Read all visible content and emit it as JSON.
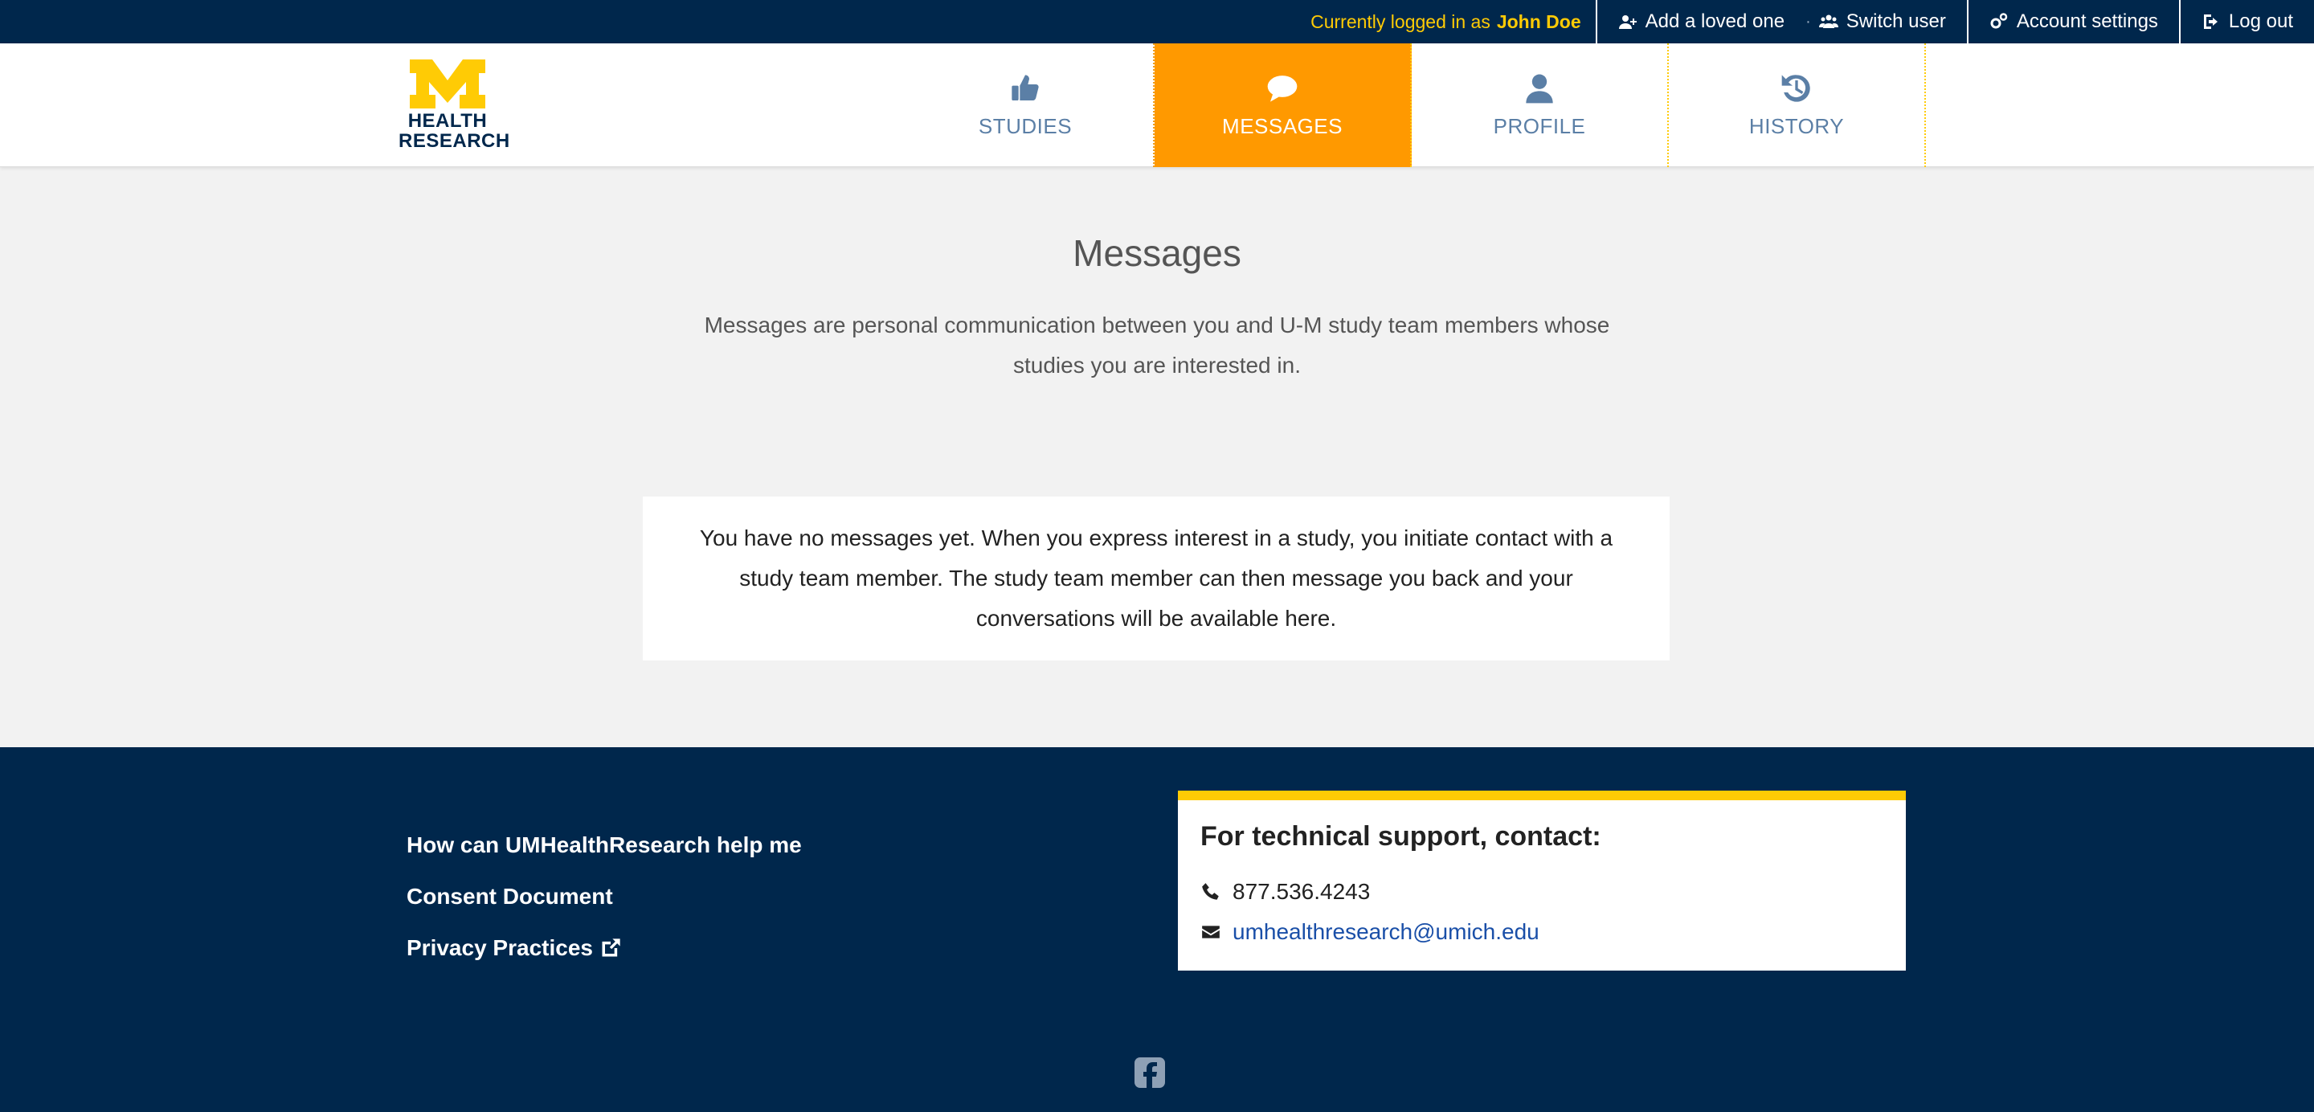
{
  "topbar": {
    "logged_in_prefix": "Currently logged in as",
    "user_name": "John Doe",
    "add_loved_one": "Add a loved one",
    "separator": "·",
    "switch_user": "Switch user",
    "account_settings": "Account settings",
    "log_out": "Log out"
  },
  "header": {
    "logo_line1": "HEALTH",
    "logo_line2": "RESEARCH",
    "nav": [
      {
        "label": "STUDIES",
        "icon": "thumbs-up-icon"
      },
      {
        "label": "MESSAGES",
        "icon": "comment-icon",
        "active": true
      },
      {
        "label": "PROFILE",
        "icon": "user-icon"
      },
      {
        "label": "HISTORY",
        "icon": "history-icon"
      }
    ]
  },
  "main": {
    "title": "Messages",
    "intro": "Messages are personal communication between you and U-M study team members whose studies you are interested in.",
    "empty_message": "You have no messages yet. When you express interest in a study, you initiate contact with a study team member. The study team member can then message you back and your conversations will be available here."
  },
  "footer": {
    "links": [
      "How can UMHealthResearch help me",
      "Consent Document",
      "Privacy Practices"
    ],
    "support_title": "For technical support, contact:",
    "phone": "877.536.4243",
    "email": "umhealthresearch@umich.edu"
  },
  "colors": {
    "navy": "#00274c",
    "maize": "#ffcb05",
    "active_tab": "#ff9900",
    "nav_text": "#5b7fa6",
    "link_blue": "#1a4fa8"
  }
}
